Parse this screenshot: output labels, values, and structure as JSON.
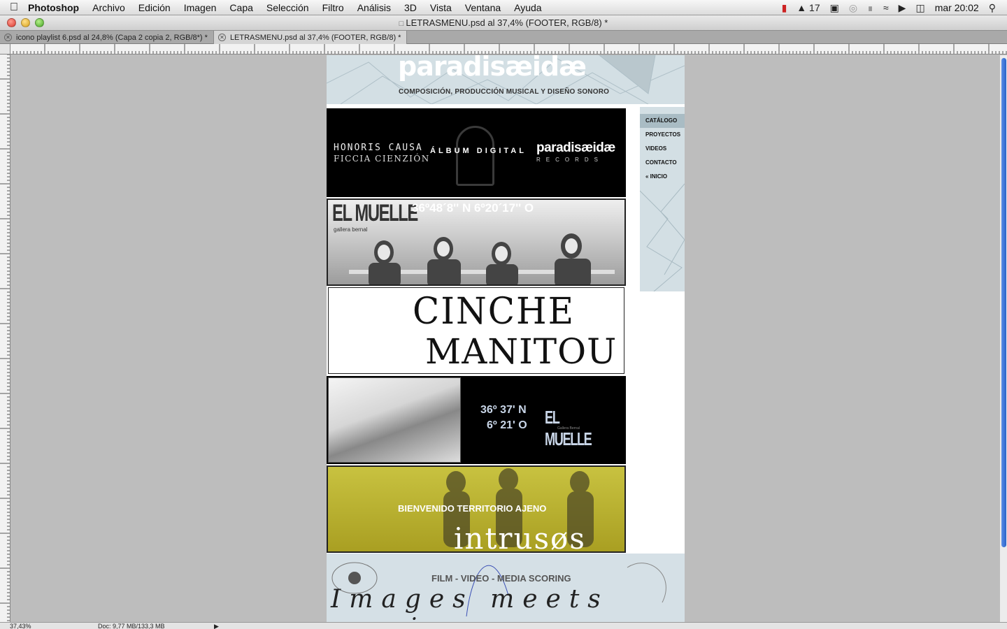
{
  "menubar": {
    "app_name": "Photoshop",
    "items": [
      "Archivo",
      "Edición",
      "Imagen",
      "Capa",
      "Selección",
      "Filtro",
      "Análisis",
      "3D",
      "Vista",
      "Ventana",
      "Ayuda"
    ],
    "adobe_count": "17",
    "clock": "mar 20:02"
  },
  "window": {
    "title": "LETRASMENU.psd al 37,4% (FOOTER, RGB/8) *"
  },
  "tabs": [
    {
      "label": "icono playlist 6.psd al 24,8% (Capa 2 copia 2, RGB/8*) *"
    },
    {
      "label": "LETRASMENU.psd al 37,4% (FOOTER, RGB/8) *"
    }
  ],
  "status": {
    "zoom": "37,43%",
    "doc_size": "Doc: 9,77 MB/133,3 MB"
  },
  "document": {
    "header": {
      "logo": "paradisæidæ",
      "subtitle": "COMPOSICIÓN, PRODUCCIÓN MUSICAL Y DISEÑO SONORO"
    },
    "banner1": {
      "line1": "HONORIS CAUSA",
      "line2": "FICCIA CIENZIÓN",
      "album": "ÁLBUM DIGITAL",
      "brand": "paradisæidæ",
      "records": "RECORDS"
    },
    "banner2": {
      "logo": "EL MUELLE",
      "sub": "gallera bernal",
      "coords": "36º48´8'' N 6º20´17'' O"
    },
    "banner3": {
      "line1": "CINCHE",
      "line2": "MANITOU"
    },
    "banner4": {
      "coord1": "36º 37' N",
      "coord2": "6º 21' O",
      "logo": "EL MUELLE",
      "sub": "Gallera Bernal"
    },
    "banner5": {
      "welcome": "BIENVENIDO TERRITORIO AJENO",
      "title": "intrusøs"
    },
    "sidebar": [
      "CATÁLOGO",
      "PROYECTOS",
      "VIDEOS",
      "CONTACTO",
      "« INICIO"
    ],
    "footer": {
      "tagline": "FILM - VIDEO - MEDIA SCORING",
      "script": "Images meets music"
    }
  }
}
